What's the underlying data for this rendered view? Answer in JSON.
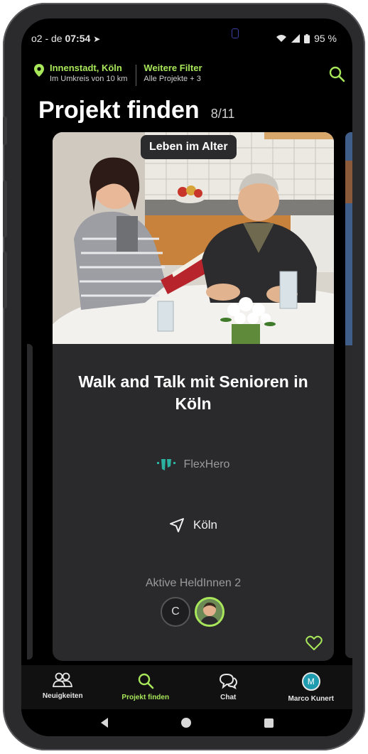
{
  "status_bar": {
    "carrier": "o2 - de",
    "time": "07:54",
    "battery": "95 %"
  },
  "filters": {
    "location_title": "Innenstadt, Köln",
    "location_sub": "Im Umkreis von 10 km",
    "more_title": "Weitere Filter",
    "more_sub": "Alle Projekte + 3"
  },
  "header": {
    "title": "Projekt finden",
    "count": "8/11"
  },
  "card": {
    "category": "Leben im Alter",
    "title": "Walk and Talk mit Senioren in Köln",
    "organization": "FlexHero",
    "city": "Köln",
    "heroes_label": "Aktive HeldInnen 2",
    "avatar_initial": "C"
  },
  "tabs": [
    {
      "label": "Neuigkeiten",
      "icon": "people-icon"
    },
    {
      "label": "Projekt finden",
      "icon": "search-icon"
    },
    {
      "label": "Chat",
      "icon": "chat-icon"
    },
    {
      "label": "Marco Kunert",
      "icon": "avatar",
      "initial": "M"
    }
  ],
  "colors": {
    "accent": "#a8e65a",
    "card": "#2a2a2c",
    "avatar_user": "#1f9bb0"
  }
}
